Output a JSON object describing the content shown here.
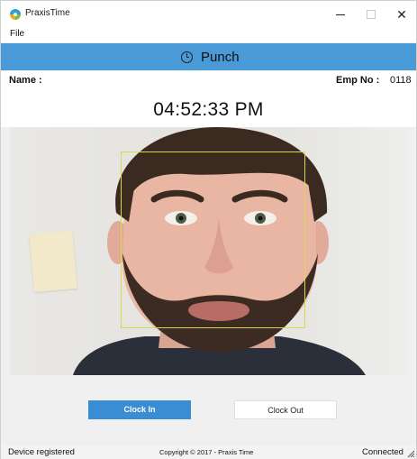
{
  "window": {
    "title": "PraxisTime",
    "minimize_icon": "minimize-icon",
    "maximize_icon": "maximize-icon",
    "close_glyph": "✕"
  },
  "menu": {
    "file_label": "File"
  },
  "header": {
    "icon": "clock-icon",
    "title": "Punch",
    "background": "#4a9ad8"
  },
  "info": {
    "name_label": "Name :",
    "name_value": "",
    "emp_label": "Emp No :",
    "emp_value": "0118"
  },
  "clock": {
    "time": "04:52:33 PM"
  },
  "camera": {
    "face_box_color": "#d8d84a"
  },
  "buttons": {
    "clock_in": "Clock In",
    "clock_out": "Clock Out",
    "accent": "#3a8dd3"
  },
  "status": {
    "left": "Device registered",
    "center": "Copyright © 2017 - Praxis Time",
    "right": "Connected"
  }
}
